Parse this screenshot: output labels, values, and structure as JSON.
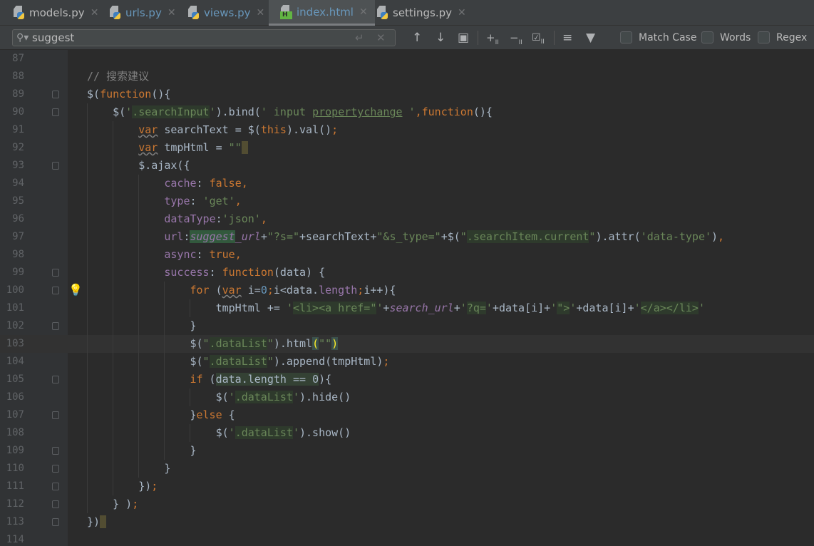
{
  "tabs": [
    {
      "label": "models.py",
      "icon": "python-file-icon",
      "active": false,
      "color": "#bbbbbb"
    },
    {
      "label": "urls.py",
      "icon": "python-file-icon",
      "active": false,
      "color": "#6897bb"
    },
    {
      "label": "views.py",
      "icon": "python-file-icon",
      "active": false,
      "color": "#6897bb"
    },
    {
      "label": "index.html",
      "icon": "html-file-icon",
      "active": true,
      "color": "#6897bb"
    },
    {
      "label": "settings.py",
      "icon": "python-file-icon",
      "active": false,
      "color": "#bbbbbb"
    }
  ],
  "find": {
    "query": "suggest",
    "match_case": "Match Case",
    "words": "Words",
    "regex": "Regex",
    "match_case_checked": false,
    "words_checked": false,
    "regex_checked": false
  },
  "editor": {
    "current_line": 103,
    "lines": [
      {
        "n": 87,
        "i": 0,
        "t": []
      },
      {
        "n": 88,
        "i": 0,
        "t": [
          [
            "// 搜索建议",
            "c"
          ]
        ]
      },
      {
        "n": 89,
        "i": 0,
        "fold": true,
        "t": [
          [
            "$(",
            "d"
          ],
          [
            "function",
            "k"
          ],
          [
            "(){",
            "d"
          ]
        ]
      },
      {
        "n": 90,
        "i": 4,
        "fold": true,
        "t": [
          [
            "$(",
            "d"
          ],
          [
            "'",
            "s"
          ],
          [
            ".searchInput",
            "sh"
          ],
          [
            "'",
            "s"
          ],
          [
            ").bind(",
            "d"
          ],
          [
            "' input ",
            "s"
          ],
          [
            "propertychange",
            "s u"
          ],
          [
            " '",
            "s"
          ],
          [
            ",",
            "k"
          ],
          [
            "function",
            "k"
          ],
          [
            "(){",
            "d"
          ]
        ]
      },
      {
        "n": 91,
        "i": 8,
        "t": [
          [
            "var",
            "k w"
          ],
          [
            " searchText = $(",
            "d"
          ],
          [
            "this",
            "k"
          ],
          [
            ").val()",
            "d"
          ],
          [
            ";",
            "k"
          ]
        ]
      },
      {
        "n": 92,
        "i": 8,
        "t": [
          [
            "var",
            "k w"
          ],
          [
            " tmpHtml = ",
            "d"
          ],
          [
            "\"\"",
            "s"
          ],
          [
            " ",
            "caret"
          ]
        ]
      },
      {
        "n": 93,
        "i": 8,
        "fold": true,
        "t": [
          [
            "$.ajax({",
            "d"
          ]
        ]
      },
      {
        "n": 94,
        "i": 12,
        "t": [
          [
            "cache",
            "p"
          ],
          [
            ": ",
            "d"
          ],
          [
            "false",
            "k"
          ],
          [
            ",",
            "k"
          ]
        ]
      },
      {
        "n": 95,
        "i": 12,
        "t": [
          [
            "type",
            "p"
          ],
          [
            ": ",
            "d"
          ],
          [
            "'get'",
            "s"
          ],
          [
            ",",
            "k"
          ]
        ]
      },
      {
        "n": 96,
        "i": 12,
        "t": [
          [
            "dataType",
            "p"
          ],
          [
            ":",
            "d"
          ],
          [
            "'json'",
            "s"
          ],
          [
            ",",
            "k"
          ]
        ]
      },
      {
        "n": 97,
        "i": 12,
        "t": [
          [
            "url",
            "p"
          ],
          [
            ":",
            "d"
          ],
          [
            "suggest",
            "m"
          ],
          [
            "_url",
            "iv"
          ],
          [
            "+",
            "d"
          ],
          [
            "\"?s=\"",
            "s"
          ],
          [
            "+searchText+",
            "d"
          ],
          [
            "\"&s_type=\"",
            "s"
          ],
          [
            "+$(",
            "d"
          ],
          [
            "\"",
            "s"
          ],
          [
            ".searchItem.current",
            "sh"
          ],
          [
            "\"",
            "s"
          ],
          [
            ").attr(",
            "d"
          ],
          [
            "'data-type'",
            "s"
          ],
          [
            ")",
            "d"
          ],
          [
            ",",
            "k"
          ]
        ]
      },
      {
        "n": 98,
        "i": 12,
        "t": [
          [
            "async",
            "p"
          ],
          [
            ": ",
            "d"
          ],
          [
            "true",
            "k"
          ],
          [
            ",",
            "k"
          ]
        ]
      },
      {
        "n": 99,
        "i": 12,
        "fold": true,
        "t": [
          [
            "success",
            "p"
          ],
          [
            ": ",
            "d"
          ],
          [
            "function",
            "k"
          ],
          [
            "(data) {",
            "d"
          ]
        ]
      },
      {
        "n": 100,
        "i": 16,
        "fold": true,
        "t": [
          [
            "for",
            "k"
          ],
          [
            " (",
            "d"
          ],
          [
            "var",
            "k w"
          ],
          [
            " i=",
            "d"
          ],
          [
            "0",
            "n"
          ],
          [
            ";",
            "k"
          ],
          [
            "i<data.",
            "d"
          ],
          [
            "length",
            "p"
          ],
          [
            ";",
            "k"
          ],
          [
            "i++){",
            "d"
          ]
        ]
      },
      {
        "n": 101,
        "i": 20,
        "t": [
          [
            "tmpHtml += ",
            "d"
          ],
          [
            "'",
            "s"
          ],
          [
            "<li><a href=\"",
            "sh"
          ],
          [
            "'",
            "s"
          ],
          [
            "+",
            "d"
          ],
          [
            "search_url",
            "iv"
          ],
          [
            "+",
            "d"
          ],
          [
            "'",
            "s"
          ],
          [
            "?q=",
            "sh"
          ],
          [
            "'",
            "s"
          ],
          [
            "+data[i]+",
            "d"
          ],
          [
            "'",
            "s"
          ],
          [
            "\">",
            "sh"
          ],
          [
            "'",
            "s"
          ],
          [
            "+data[i]+",
            "d"
          ],
          [
            "'",
            "s"
          ],
          [
            "</a></li>",
            "sh"
          ],
          [
            "'",
            "s"
          ]
        ]
      },
      {
        "n": 102,
        "i": 16,
        "fold": true,
        "t": [
          [
            "}",
            "d"
          ]
        ]
      },
      {
        "n": 103,
        "i": 16,
        "t": [
          [
            "$(",
            "d"
          ],
          [
            "\"",
            "s"
          ],
          [
            ".dataList",
            "sh"
          ],
          [
            "\"",
            "s"
          ],
          [
            ").html",
            "d"
          ],
          [
            "(",
            "bm"
          ],
          [
            "\"\"",
            "s"
          ],
          [
            ")",
            "bm"
          ]
        ]
      },
      {
        "n": 104,
        "i": 16,
        "t": [
          [
            "$(",
            "d"
          ],
          [
            "\"",
            "s"
          ],
          [
            ".dataList",
            "sh"
          ],
          [
            "\"",
            "s"
          ],
          [
            ").append(tmpHtml)",
            "d"
          ],
          [
            ";",
            "k"
          ]
        ]
      },
      {
        "n": 105,
        "i": 16,
        "fold": true,
        "t": [
          [
            "if",
            "k"
          ],
          [
            " (",
            "d"
          ],
          [
            "data.",
            "hl"
          ],
          [
            "length",
            "p hl"
          ],
          [
            " == ",
            "hl"
          ],
          [
            "0",
            "n hl"
          ],
          [
            "){",
            "d"
          ]
        ]
      },
      {
        "n": 106,
        "i": 20,
        "t": [
          [
            "$(",
            "d"
          ],
          [
            "'",
            "s"
          ],
          [
            ".dataList",
            "sh"
          ],
          [
            "'",
            "s"
          ],
          [
            ").hide()",
            "d"
          ]
        ]
      },
      {
        "n": 107,
        "i": 16,
        "fold": true,
        "t": [
          [
            "}",
            "d"
          ],
          [
            "else",
            "k"
          ],
          [
            " {",
            "d"
          ]
        ]
      },
      {
        "n": 108,
        "i": 20,
        "t": [
          [
            "$(",
            "d"
          ],
          [
            "'",
            "s"
          ],
          [
            ".dataList",
            "sh"
          ],
          [
            "'",
            "s"
          ],
          [
            ").show()",
            "d"
          ]
        ]
      },
      {
        "n": 109,
        "i": 16,
        "fold": true,
        "t": [
          [
            "}",
            "d"
          ]
        ]
      },
      {
        "n": 110,
        "i": 12,
        "fold": true,
        "t": [
          [
            "}",
            "d"
          ]
        ]
      },
      {
        "n": 111,
        "i": 8,
        "fold": true,
        "t": [
          [
            "})",
            "d"
          ],
          [
            ";",
            "k"
          ]
        ]
      },
      {
        "n": 112,
        "i": 4,
        "fold": true,
        "t": [
          [
            "} )",
            "d"
          ],
          [
            ";",
            "k"
          ]
        ]
      },
      {
        "n": 113,
        "i": 0,
        "fold": true,
        "t": [
          [
            "})",
            "d"
          ],
          [
            " ",
            "caret"
          ]
        ]
      },
      {
        "n": 114,
        "i": 0,
        "t": []
      }
    ]
  },
  "colors": {
    "background": "#2b2b2b",
    "keyword": "#cc7832",
    "string": "#6a8759",
    "property": "#9876aa",
    "match": "#32593d"
  }
}
